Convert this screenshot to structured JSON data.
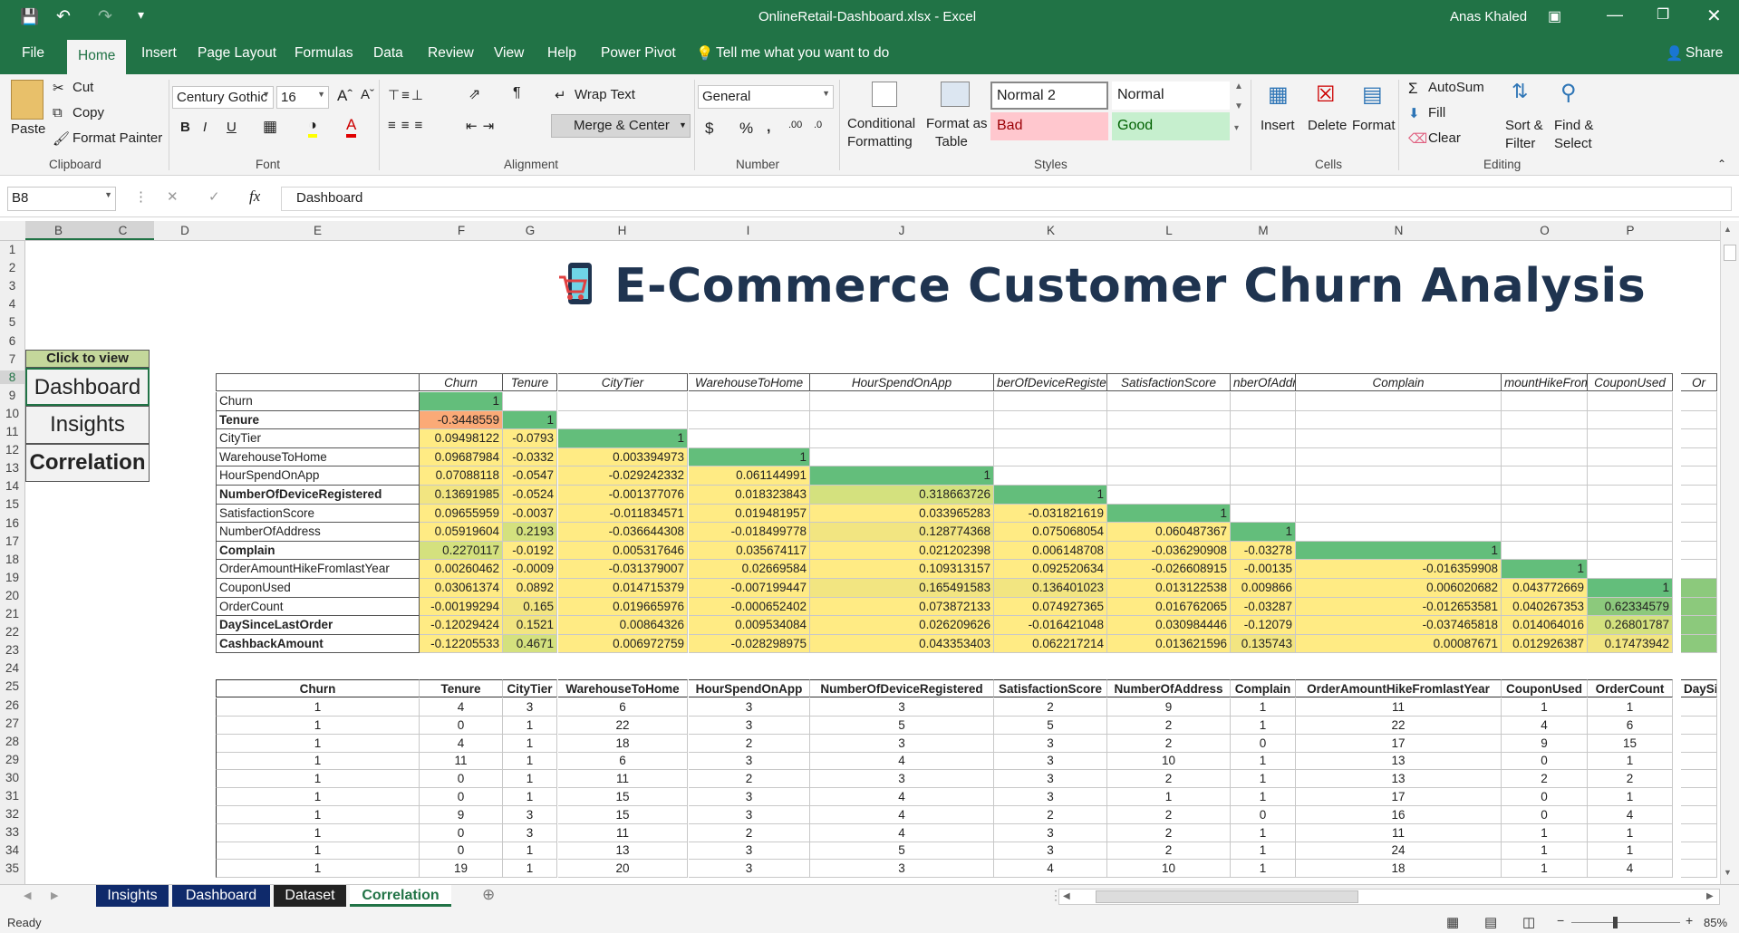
{
  "app": {
    "doc_title": "OnlineRetail-Dashboard.xlsx  -  Excel",
    "user": "Anas Khaled"
  },
  "menu": {
    "tabs": [
      "File",
      "Home",
      "Insert",
      "Page Layout",
      "Formulas",
      "Data",
      "Review",
      "View",
      "Help",
      "Power Pivot"
    ],
    "tell_me": "Tell me what you want to do",
    "share": "Share"
  },
  "ribbon": {
    "clipboard": {
      "paste": "Paste",
      "cut": "Cut",
      "copy": "Copy",
      "format_painter": "Format Painter",
      "group": "Clipboard"
    },
    "font": {
      "name": "Century Gothic",
      "size": "16",
      "group": "Font"
    },
    "alignment": {
      "wrap": "Wrap Text",
      "merge": "Merge & Center",
      "group": "Alignment"
    },
    "number": {
      "format": "General",
      "group": "Number"
    },
    "styles": {
      "cond1": "Conditional",
      "cond2": "Formatting",
      "fmt1": "Format as",
      "fmt2": "Table",
      "normal2": "Normal 2",
      "normal": "Normal",
      "bad": "Bad",
      "good": "Good",
      "group": "Styles"
    },
    "cells": {
      "insert": "Insert",
      "delete": "Delete",
      "format": "Format",
      "group": "Cells"
    },
    "editing": {
      "autosum": "AutoSum",
      "fill": "Fill",
      "clear": "Clear",
      "sort1": "Sort &",
      "sort2": "Filter",
      "find1": "Find &",
      "find2": "Select",
      "group": "Editing"
    }
  },
  "formula_bar": {
    "name_box": "B8",
    "value": "Dashboard"
  },
  "columns": [
    "B",
    "C",
    "D",
    "E",
    "F",
    "G",
    "H",
    "I",
    "J",
    "K",
    "L",
    "M",
    "N",
    "O",
    "P"
  ],
  "rows": [
    "1",
    "2",
    "3",
    "4",
    "5",
    "6",
    "7",
    "8",
    "9",
    "10",
    "11",
    "12",
    "13",
    "14",
    "15",
    "16",
    "17",
    "18",
    "19",
    "20",
    "21",
    "22",
    "23",
    "24",
    "25",
    "26",
    "27",
    "28",
    "29",
    "30",
    "31",
    "32",
    "33",
    "34",
    "35"
  ],
  "dashboard": {
    "title": "E-Commerce Customer Churn Analysis",
    "click_to_view": "Click to view",
    "nav": [
      "Dashboard",
      "Insights",
      "Correlation"
    ]
  },
  "corr": {
    "headers": [
      "Churn",
      "Tenure",
      "CityTier",
      "WarehouseToHome",
      "HourSpendOnApp",
      "berOfDeviceRegiste",
      "SatisfactionScore",
      "nberOfAddr",
      "Complain",
      "mountHikeFrom",
      "CouponUsed",
      "Or"
    ],
    "rows": [
      {
        "label": "Churn",
        "bold": false,
        "values": [
          "1",
          "",
          "",
          "",
          "",
          "",
          "",
          "",
          "",
          "",
          ""
        ]
      },
      {
        "label": "Tenure",
        "bold": true,
        "values": [
          "-0.3448559",
          "1",
          "",
          "",
          "",
          "",
          "",
          "",
          "",
          "",
          ""
        ]
      },
      {
        "label": "CityTier",
        "bold": false,
        "values": [
          "0.09498122",
          "-0.0793",
          "1",
          "",
          "",
          "",
          "",
          "",
          "",
          "",
          ""
        ]
      },
      {
        "label": "WarehouseToHome",
        "bold": false,
        "values": [
          "0.09687984",
          "-0.0332",
          "0.003394973",
          "1",
          "",
          "",
          "",
          "",
          "",
          "",
          ""
        ]
      },
      {
        "label": "HourSpendOnApp",
        "bold": false,
        "values": [
          "0.07088118",
          "-0.0547",
          "-0.029242332",
          "0.061144991",
          "1",
          "",
          "",
          "",
          "",
          "",
          ""
        ]
      },
      {
        "label": "NumberOfDeviceRegistered",
        "bold": true,
        "values": [
          "0.13691985",
          "-0.0524",
          "-0.001377076",
          "0.018323843",
          "0.318663726",
          "1",
          "",
          "",
          "",
          "",
          ""
        ]
      },
      {
        "label": "SatisfactionScore",
        "bold": false,
        "values": [
          "0.09655959",
          "-0.0037",
          "-0.011834571",
          "0.019481957",
          "0.033965283",
          "-0.031821619",
          "1",
          "",
          "",
          "",
          ""
        ]
      },
      {
        "label": "NumberOfAddress",
        "bold": false,
        "values": [
          "0.05919604",
          "0.2193",
          "-0.036644308",
          "-0.018499778",
          "0.128774368",
          "0.075068054",
          "0.060487367",
          "1",
          "",
          "",
          ""
        ]
      },
      {
        "label": "Complain",
        "bold": true,
        "values": [
          "0.2270117",
          "-0.0192",
          "0.005317646",
          "0.035674117",
          "0.021202398",
          "0.006148708",
          "-0.036290908",
          "-0.03278",
          "1",
          "",
          ""
        ]
      },
      {
        "label": "OrderAmountHikeFromlastYear",
        "bold": false,
        "values": [
          "0.00260462",
          "-0.0009",
          "-0.031379007",
          "0.02669584",
          "0.109313157",
          "0.092520634",
          "-0.026608915",
          "-0.00135",
          "-0.016359908",
          "1",
          ""
        ]
      },
      {
        "label": "CouponUsed",
        "bold": false,
        "values": [
          "0.03061374",
          "0.0892",
          "0.014715379",
          "-0.007199447",
          "0.165491583",
          "0.136401023",
          "0.013122538",
          "0.009866",
          "0.006020682",
          "0.043772669",
          "1"
        ]
      },
      {
        "label": "OrderCount",
        "bold": false,
        "values": [
          "-0.00199294",
          "0.165",
          "0.019665976",
          "-0.000652402",
          "0.073872133",
          "0.074927365",
          "0.016762065",
          "-0.03287",
          "-0.012653581",
          "0.040267353",
          "0.62334579"
        ]
      },
      {
        "label": "DaySinceLastOrder",
        "bold": true,
        "values": [
          "-0.12029424",
          "0.1521",
          "0.00864326",
          "0.009534084",
          "0.026209626",
          "-0.016421048",
          "0.030984446",
          "-0.12079",
          "-0.037465818",
          "0.014064016",
          "0.26801787"
        ]
      },
      {
        "label": "CashbackAmount",
        "bold": true,
        "values": [
          "-0.12205533",
          "0.4671",
          "0.006972759",
          "-0.028298975",
          "0.043353403",
          "0.062217214",
          "0.013621596",
          "0.135743",
          "0.00087671",
          "0.012926387",
          "0.17473942"
        ]
      }
    ]
  },
  "data_table": {
    "headers": [
      "Churn",
      "Tenure",
      "CityTier",
      "WarehouseToHome",
      "HourSpendOnApp",
      "NumberOfDeviceRegistered",
      "SatisfactionScore",
      "NumberOfAddress",
      "Complain",
      "OrderAmountHikeFromlastYear",
      "CouponUsed",
      "OrderCount",
      "DaySin"
    ],
    "rows": [
      [
        "1",
        "4",
        "3",
        "6",
        "3",
        "3",
        "2",
        "9",
        "1",
        "11",
        "1",
        "1",
        ""
      ],
      [
        "1",
        "0",
        "1",
        "22",
        "3",
        "5",
        "5",
        "2",
        "1",
        "22",
        "4",
        "6",
        ""
      ],
      [
        "1",
        "4",
        "1",
        "18",
        "2",
        "3",
        "3",
        "2",
        "0",
        "17",
        "9",
        "15",
        ""
      ],
      [
        "1",
        "11",
        "1",
        "6",
        "3",
        "4",
        "3",
        "10",
        "1",
        "13",
        "0",
        "1",
        ""
      ],
      [
        "1",
        "0",
        "1",
        "11",
        "2",
        "3",
        "3",
        "2",
        "1",
        "13",
        "2",
        "2",
        ""
      ],
      [
        "1",
        "0",
        "1",
        "15",
        "3",
        "4",
        "3",
        "1",
        "1",
        "17",
        "0",
        "1",
        ""
      ],
      [
        "1",
        "9",
        "3",
        "15",
        "3",
        "4",
        "2",
        "2",
        "0",
        "16",
        "0",
        "4",
        ""
      ],
      [
        "1",
        "0",
        "3",
        "11",
        "2",
        "4",
        "3",
        "2",
        "1",
        "11",
        "1",
        "1",
        ""
      ],
      [
        "1",
        "0",
        "1",
        "13",
        "3",
        "5",
        "3",
        "2",
        "1",
        "24",
        "1",
        "1",
        ""
      ],
      [
        "1",
        "19",
        "1",
        "20",
        "3",
        "3",
        "4",
        "10",
        "1",
        "18",
        "1",
        "4",
        ""
      ]
    ]
  },
  "sheet_tabs": [
    "Insights",
    "Dashboard",
    "Dataset",
    "Correlation"
  ],
  "status": {
    "ready": "Ready",
    "zoom": "85%"
  },
  "colors": {
    "excel_green": "#217346",
    "cell_green": "#63be7b",
    "cell_yellow": "#ffeb84",
    "cell_orange": "#fbaa77",
    "title_navy": "#1f3450",
    "tab_navy": "#0f2a6b"
  }
}
